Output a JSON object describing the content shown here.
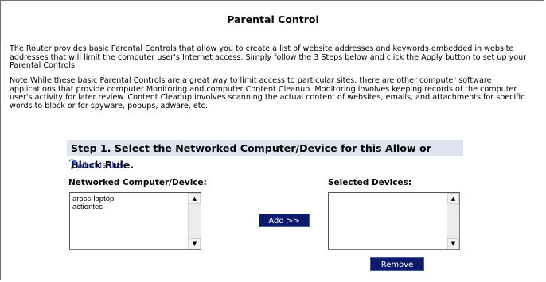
{
  "page": {
    "title": "Parental Control",
    "intro": "The Router provides basic Parental Controls that allow you to create a list of website addresses and keywords embedded in website addresses that will limit the computer user's Internet access. Simply follow the 3 Steps below and click the Apply button to set up your Parental Controls.",
    "note": "Note:While these basic Parental Controls are a great way to limit access to particular sites, there are other computer software applications that provide computer Monitoring and computer Content Cleanup. Monitoring involves keeping records of the computer user's activity for later review. Content Cleanup involves scanning the actual content of websites, emails, and attachments for specific words to block or for spyware, popups, adware, etc."
  },
  "step1": {
    "header": "Step 1. Select the Networked Computer/Device for this Allow or Block Rule.",
    "help_icon": "?",
    "help_link": "What is this",
    "networked_label": "Networked Computer/Device:",
    "selected_label": "Selected Devices:",
    "networked_devices": [
      "aross-laptop",
      "actiontec"
    ],
    "selected_devices": [],
    "add_button": "Add >>",
    "remove_button": "Remove"
  },
  "colors": {
    "header_bg": "#dfe3ef",
    "button_bg": "#0d1a6b",
    "link": "#1d2fa8"
  },
  "icons": {
    "help": "question-mark-icon",
    "scroll_up": "arrow-up-icon",
    "scroll_down": "arrow-down-icon"
  }
}
